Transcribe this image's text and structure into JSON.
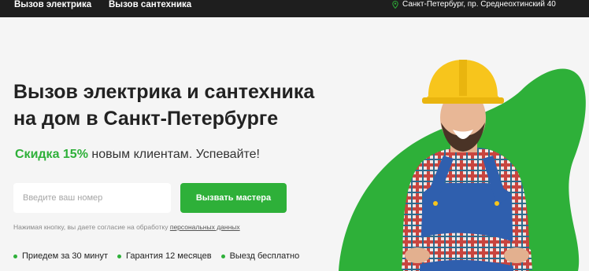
{
  "nav": {
    "items": [
      {
        "label": "Вызов электрика"
      },
      {
        "label": "Вызов сантехника"
      }
    ],
    "address": "Санкт-Петербург, пр. Среднеохтинский 40",
    "address_icon": "map-pin-icon"
  },
  "hero": {
    "title_line1": "Вызов электрика и сантехника",
    "title_line2": "на дом в Санкт-Петербурге",
    "promo_accent": "Скидка 15%",
    "promo_rest": " новым клиентам. Успевайте!"
  },
  "form": {
    "phone_placeholder": "Введите ваш номер",
    "phone_value": "",
    "submit_label": "Вызвать мастера",
    "consent_text": "Нажимая кнопку, вы даете согласие на обработку ",
    "consent_link": "персональных данных"
  },
  "features": [
    {
      "label": "Приедем за 30 минут"
    },
    {
      "label": "Гарантия 12 месяцев"
    },
    {
      "label": "Выезд бесплатно"
    }
  ],
  "colors": {
    "accent": "#2eb039",
    "topbar": "#1e1e1e",
    "background": "#f5f5f5",
    "helmet": "#f7c51c",
    "overalls": "#2f5fae"
  }
}
